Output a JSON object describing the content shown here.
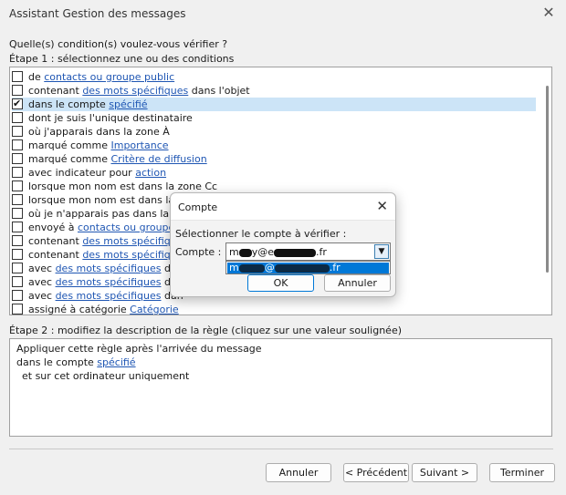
{
  "window": {
    "title": "Assistant Gestion des messages"
  },
  "question": "Quelle(s) condition(s) voulez-vous vérifier ?",
  "step1_label": "Étape 1 : sélectionnez une ou des conditions",
  "conditions": [
    {
      "pre": "de ",
      "link": "contacts ou groupe public",
      "post": "",
      "checked": false
    },
    {
      "pre": "contenant ",
      "link": "des mots spécifiques",
      "post": " dans l'objet",
      "checked": false
    },
    {
      "pre": "dans le compte ",
      "link": "spécifié",
      "post": "",
      "checked": true,
      "selected": true
    },
    {
      "pre": "dont je suis l'unique destinataire",
      "link": "",
      "post": "",
      "checked": false
    },
    {
      "pre": "où j'apparais dans la zone À",
      "link": "",
      "post": "",
      "checked": false
    },
    {
      "pre": "marqué comme ",
      "link": "Importance",
      "post": "",
      "checked": false
    },
    {
      "pre": "marqué comme ",
      "link": "Critère de diffusion",
      "post": "",
      "checked": false
    },
    {
      "pre": "avec indicateur pour ",
      "link": "action ",
      "post": "",
      "checked": false
    },
    {
      "pre": "lorsque mon nom est dans la zone Cc",
      "link": "",
      "post": "",
      "checked": false
    },
    {
      "pre": "lorsque mon nom est dans la z",
      "link": "",
      "post": "",
      "checked": false
    },
    {
      "pre": "où je n'apparais pas dans la zo",
      "link": "",
      "post": "",
      "checked": false
    },
    {
      "pre": "envoyé à ",
      "link": "contacts ou groupe p",
      "post": "",
      "checked": false
    },
    {
      "pre": "contenant ",
      "link": "des mots spécifique",
      "post": "",
      "checked": false
    },
    {
      "pre": "contenant ",
      "link": "des mots spécifique",
      "post": "",
      "checked": false
    },
    {
      "pre": "avec ",
      "link": "des mots spécifiques",
      "post": " dan",
      "checked": false
    },
    {
      "pre": "avec ",
      "link": "des mots spécifiques",
      "post": " dan",
      "checked": false
    },
    {
      "pre": "avec ",
      "link": "des mots spécifiques",
      "post": " dan",
      "checked": false
    },
    {
      "pre": "assigné à catégorie ",
      "link": "Catégorie",
      "post": "",
      "checked": false
    }
  ],
  "step2_label": "Étape 2 : modifiez la description de la règle (cliquez sur une valeur soulignée)",
  "description": {
    "line1": "Appliquer cette règle après l'arrivée du message",
    "line2_pre": "dans le compte ",
    "line2_link": "spécifié",
    "line3": "et sur cet ordinateur uniquement"
  },
  "buttons": {
    "cancel": "Annuler",
    "previous": "< Précédent",
    "next": "Suivant >",
    "finish": "Terminer"
  },
  "modal": {
    "title": "Compte",
    "prompt": "Sélectionner le compte à vérifier :",
    "account_label": "Compte :",
    "account_prefix": "m",
    "account_mid": "y@e",
    "account_suffix": ".fr",
    "dropdown_prefix": "m",
    "dropdown_suffix": ".fr",
    "ok": "OK",
    "cancel": "Annuler"
  },
  "icons": {
    "close": "close-icon",
    "dropdown": "chevron-down-icon",
    "check": "check-icon"
  }
}
